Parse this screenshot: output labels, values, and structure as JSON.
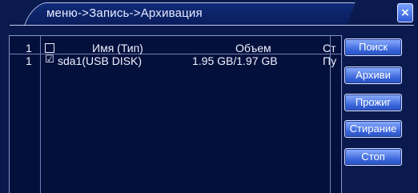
{
  "window": {
    "title": "меню->Запись->Архивация",
    "close_label": "×"
  },
  "table": {
    "header": {
      "index": "1",
      "name": "Имя (Тип)",
      "size": "Объем",
      "status": "Ст"
    },
    "rows": [
      {
        "index": "1",
        "checked": "☑",
        "name": "sda1(USB DISK)",
        "size": "1.95 GB/1.97 GB",
        "status": "Пу"
      }
    ]
  },
  "buttons": {
    "search": "Поиск",
    "archive": "Архиви",
    "burn": "Прожиг",
    "erase": "Стирание",
    "stop": "Стоп"
  }
}
